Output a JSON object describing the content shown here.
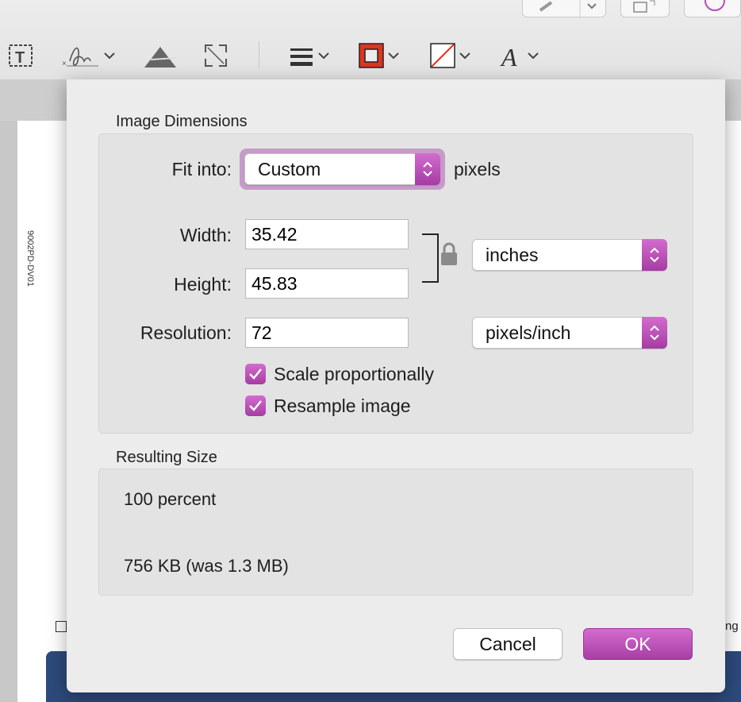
{
  "document": {
    "side_code": "9002PD-DV01",
    "edge_text": "ng"
  },
  "dialog": {
    "image_dimensions_title": "Image Dimensions",
    "fit_into_label": "Fit into:",
    "fit_into_value": "Custom",
    "fit_into_unit": "pixels",
    "width_label": "Width:",
    "width_value": "35.42",
    "height_label": "Height:",
    "height_value": "45.83",
    "size_unit": "inches",
    "resolution_label": "Resolution:",
    "resolution_value": "72",
    "resolution_unit": "pixels/inch",
    "scale_proportionally_label": "Scale proportionally",
    "scale_proportionally_checked": true,
    "resample_label": "Resample image",
    "resample_checked": true,
    "resulting_size_title": "Resulting Size",
    "percent_text": "100 percent",
    "filesize_text": "756 KB (was 1.3 MB)",
    "cancel_label": "Cancel",
    "ok_label": "OK"
  },
  "colors": {
    "accent": "#b94db8",
    "accent_focus_ring": "#c79bc9",
    "border_color_swatch": "#e0341f",
    "doc_banner": "#2d4a7c"
  },
  "toolbar_icons": [
    "text-box-icon",
    "signature-icon",
    "adjust-color-icon",
    "adjust-size-icon",
    "shape-style-icon",
    "border-color-icon",
    "fill-color-icon",
    "text-style-icon"
  ]
}
